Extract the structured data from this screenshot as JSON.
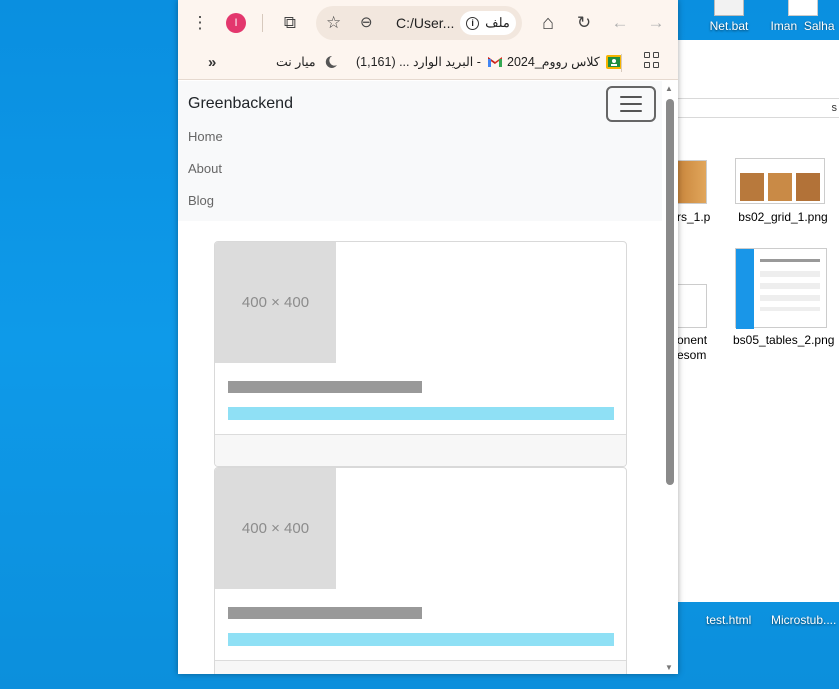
{
  "desktop": {
    "icons": [
      {
        "label": "Net.bat"
      },
      {
        "label": "Iman_Salha"
      }
    ],
    "explorer": {
      "address_fragment": "s",
      "files": [
        {
          "label": "rs_1.p"
        },
        {
          "label": "bs02_grid_1.png"
        },
        {
          "label": "onent esom"
        },
        {
          "label": "bs05_tables_2.png"
        }
      ]
    },
    "bottom_icons": [
      {
        "label": "test.html"
      },
      {
        "label": "Microstub...."
      }
    ]
  },
  "browser": {
    "toolbar": {
      "profile_initial": "I",
      "url": "C:/User...",
      "chip_label": "ملف",
      "menu_glyph": "⋮",
      "extensions_glyph": "⧉",
      "home_glyph": "⌂",
      "reload_glyph": "↻",
      "back_glyph": "←",
      "forward_glyph": "→",
      "star_glyph": "☆",
      "zoom_glyph": "⊖",
      "info_glyph": "i"
    },
    "bookmarks": {
      "overflow_glyph": "»",
      "items": [
        {
          "label": "ميار نت",
          "icon": "crescent-icon"
        },
        {
          "label": "البريد الوارد ... (1,161) -",
          "icon": "gmail-icon"
        },
        {
          "label": "كلاس رووم_2024",
          "icon": "classroom-icon"
        }
      ]
    }
  },
  "page": {
    "brand": "Greenbackend",
    "nav": [
      {
        "label": "Home"
      },
      {
        "label": "About"
      },
      {
        "label": "Blog"
      }
    ],
    "cards": [
      {
        "image_label": "400 × 400"
      },
      {
        "image_label": "400 × 400"
      }
    ]
  },
  "colors": {
    "desktop_bg": "#0e9ae9",
    "browser_toolbar": "#fdf5ef",
    "omnibox": "#f2e7de",
    "profile": "#e3376d",
    "navbar_bg": "#f8f9fa",
    "placeholder_img": "#dcdcdc",
    "title_placeholder": "#999999",
    "text_placeholder": "#8fe0f5"
  }
}
